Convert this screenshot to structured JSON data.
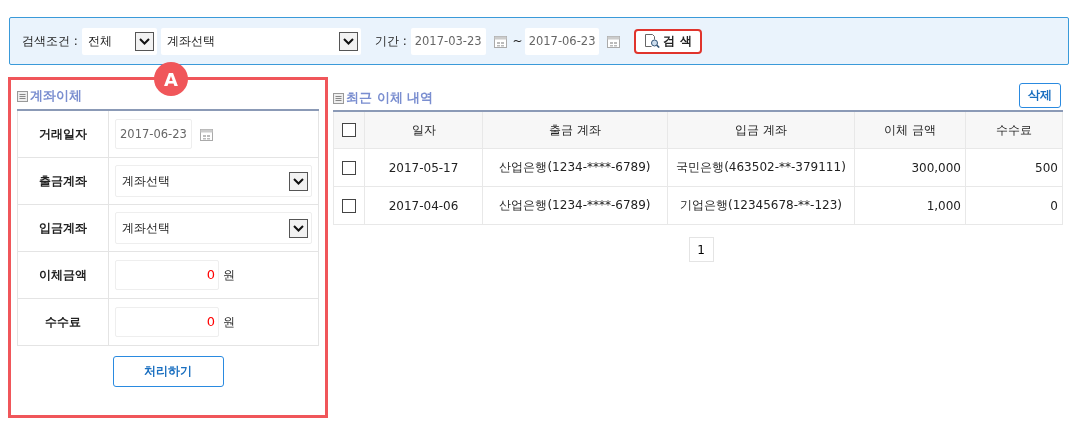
{
  "search": {
    "label": "검색조건 :",
    "scope": "전체",
    "account": "계좌선택",
    "period_label": "기간 :",
    "from": "2017-03-23",
    "separator": "~",
    "to": "2017-06-23",
    "button": "검 색"
  },
  "callout": "A",
  "transfer": {
    "title": "계좌이체",
    "fields": [
      {
        "kind": "date",
        "label": "거래일자",
        "value": "2017-06-23"
      },
      {
        "kind": "select",
        "label": "출금계좌",
        "value": "계좌선택"
      },
      {
        "kind": "select",
        "label": "입금계좌",
        "value": "계좌선택"
      },
      {
        "kind": "amount",
        "label": "이체금액",
        "value": "0",
        "unit": "원"
      },
      {
        "kind": "amount",
        "label": "수수료",
        "value": "0",
        "unit": "원"
      }
    ],
    "button": "처리하기"
  },
  "history": {
    "title": "최근 이체 내역",
    "delete_button": "삭제",
    "header_checked": false,
    "columns": [
      "일자",
      "출금 계좌",
      "입금 계좌",
      "이체 금액",
      "수수료"
    ],
    "rows": [
      {
        "checked": false,
        "cells": [
          "2017-05-17",
          "산업은행(1234-****-6789)",
          "국민은행(463502-**-379111)",
          "300,000",
          "500"
        ]
      },
      {
        "checked": false,
        "cells": [
          "2017-04-06",
          "산업은행(1234-****-6789)",
          "기업은행(12345678-**-123)",
          "1,000",
          "0"
        ]
      }
    ],
    "pages": [
      "1"
    ]
  }
}
